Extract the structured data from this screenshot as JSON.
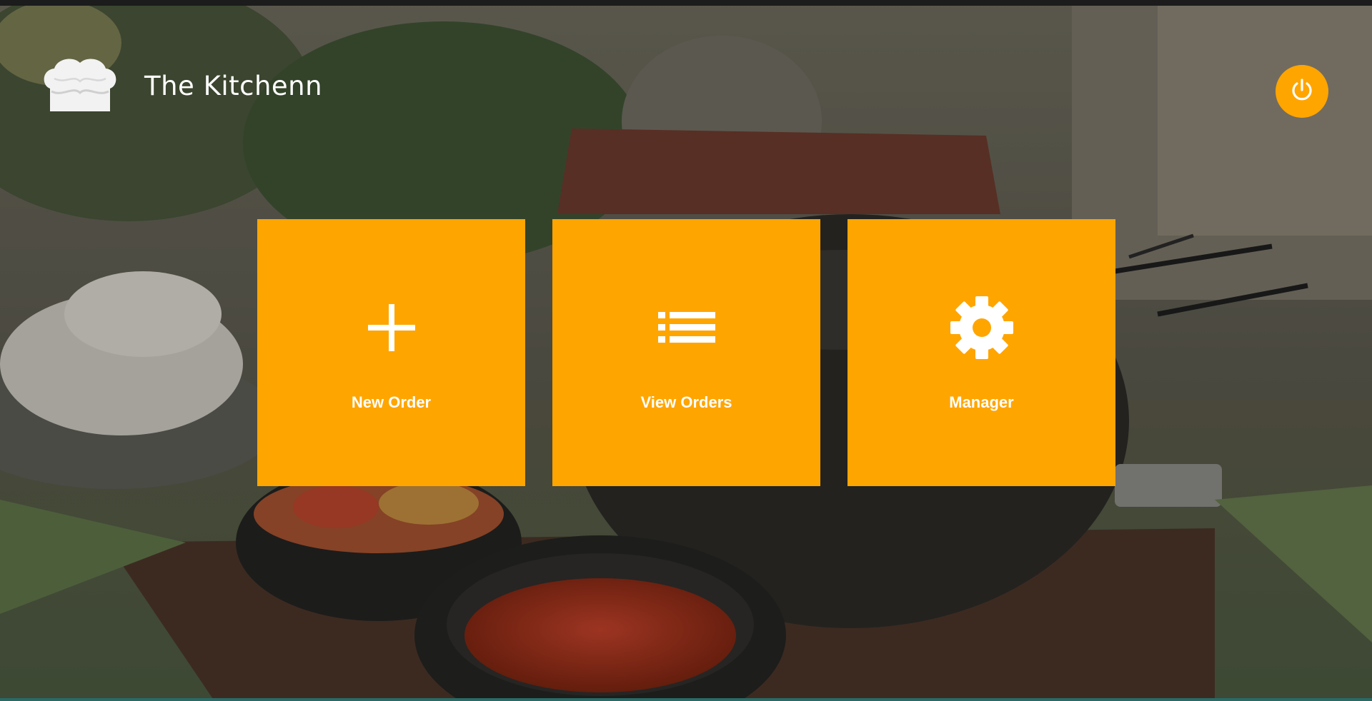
{
  "app": {
    "title": "The Kitchenn",
    "logo_icon": "chef-hat-icon"
  },
  "header": {
    "power_icon": "power-icon"
  },
  "tiles": [
    {
      "label": "New Order",
      "icon": "plus-icon"
    },
    {
      "label": "View Orders",
      "icon": "list-icon"
    },
    {
      "label": "Manager",
      "icon": "gear-icon"
    }
  ],
  "colors": {
    "accent": "#ffa500",
    "text": "#ffffff"
  }
}
